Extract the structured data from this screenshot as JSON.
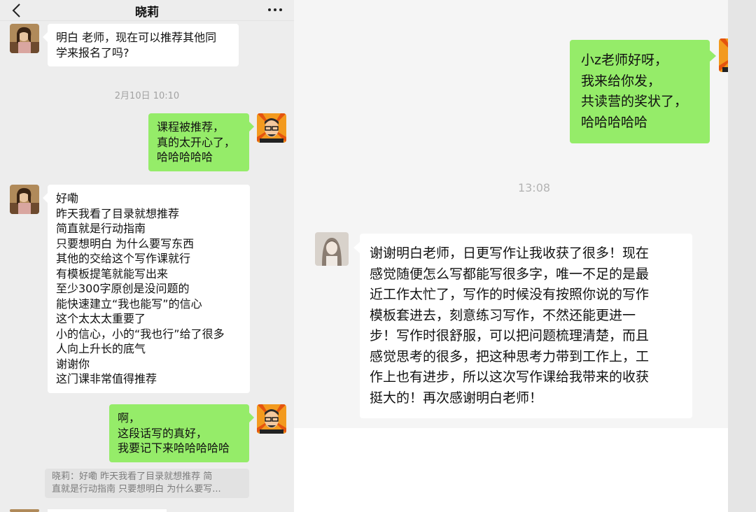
{
  "header": {
    "back_icon": "chevron-left-icon",
    "title": "晓莉",
    "more_label": "···"
  },
  "left_chat": {
    "messages": [
      {
        "sender": "晓莉",
        "side": "left",
        "text": "明白 老师，现在可以推荐其他同\n学来报名了吗?"
      },
      {
        "type": "timestamp",
        "text": "2月10日 10:10"
      },
      {
        "sender": "me",
        "side": "right",
        "text": "课程被推荐，\n真的太开心了，\n哈哈哈哈哈"
      },
      {
        "sender": "晓莉",
        "side": "left",
        "text": "好嘞\n昨天我看了目录就想推荐\n简直就是行动指南\n只要想明白 为什么要写东西\n其他的交给这个写作课就行\n有模板提笔就能写出来\n至少300字原创是没问题的\n能快速建立“我也能写”的信心\n这个太太太重要了\n小的信心，小的“我也行”给了很多\n人向上升长的底气\n谢谢你\n这门课非常值得推荐"
      },
      {
        "sender": "me",
        "side": "right",
        "text": "啊，\n这段话写的真好，\n我要记下来哈哈哈哈哈"
      }
    ],
    "quote": {
      "line1": "晓莉：好嘞 昨天我看了目录就想推荐 简",
      "line2": "直就是行动指南 只要想明白 为什么要写..."
    }
  },
  "right_chat": {
    "messages": [
      {
        "sender": "me",
        "side": "right",
        "text": "小z老师好呀，\n我来给你发，\n共读营的奖状了，\n哈哈哈哈哈"
      },
      {
        "type": "timestamp",
        "text": "13:08"
      },
      {
        "sender": "student",
        "side": "left",
        "text": "谢谢明白老师，日更写作让我收获了很多！现在\n感觉随便怎么写都能写很多字，唯一不足的是最\n近工作太忙了，写作的时候没有按照你说的写作\n模板套进去，刻意练习写作，不然还能更进一\n步！写作时很舒服，可以把问题梳理清楚，而且\n感觉思考的很多，把这种思考力带到工作上，工\n作上也有进步，所以这次写作课给我带来的收获\n挺大的！再次感谢明白老师！"
      }
    ]
  },
  "colors": {
    "chat_bg": "#ededed",
    "green_bubble": "#95ec69",
    "white_bubble": "#ffffff",
    "timestamp_text": "#a2a2a2"
  }
}
